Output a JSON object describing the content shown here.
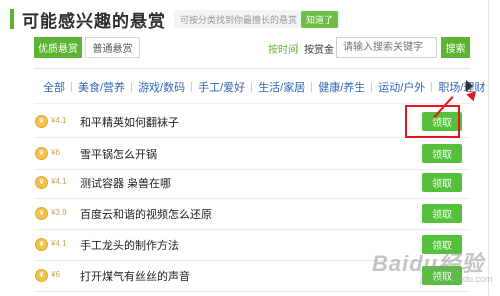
{
  "header": {
    "title": "可能感兴趣的悬赏",
    "hint": "可按分类找到你最擅长的悬赏",
    "hint_tag": "知道了"
  },
  "filter": {
    "tab_quality": "优质悬赏",
    "tab_normal": "普通悬赏",
    "sort_time": "按时间",
    "sort_reward": "按赏金",
    "search_placeholder": "请输入搜索关键字",
    "search_button": "搜索"
  },
  "categories": [
    "全部",
    "美食/营养",
    "游戏/数码",
    "手工/爱好",
    "生活/家居",
    "健康/养生",
    "运动/户外",
    "职场/理财"
  ],
  "questions": [
    {
      "reward": "¥4.1",
      "text": "和平精英如何翻袜子",
      "button": "领取"
    },
    {
      "reward": "¥6",
      "text": "雪平锅怎么开锅",
      "button": "领取"
    },
    {
      "reward": "¥4.1",
      "text": "测试容器 枭兽在哪",
      "button": "领取"
    },
    {
      "reward": "¥3.9",
      "text": "百度云和谐的视频怎么还原",
      "button": "领取"
    },
    {
      "reward": "¥4.1",
      "text": "手工龙头的制作方法",
      "button": "领取"
    },
    {
      "reward": "¥6",
      "text": "打开煤气有丝丝的声音",
      "button": "领取"
    }
  ],
  "watermark": {
    "main": "Baidu经验",
    "sub": "jingyan.baidu.com"
  },
  "colors": {
    "accent": "#5bb532",
    "claim": "#55c03a",
    "annotation": "#e6141b",
    "link": "#2f68b5"
  }
}
